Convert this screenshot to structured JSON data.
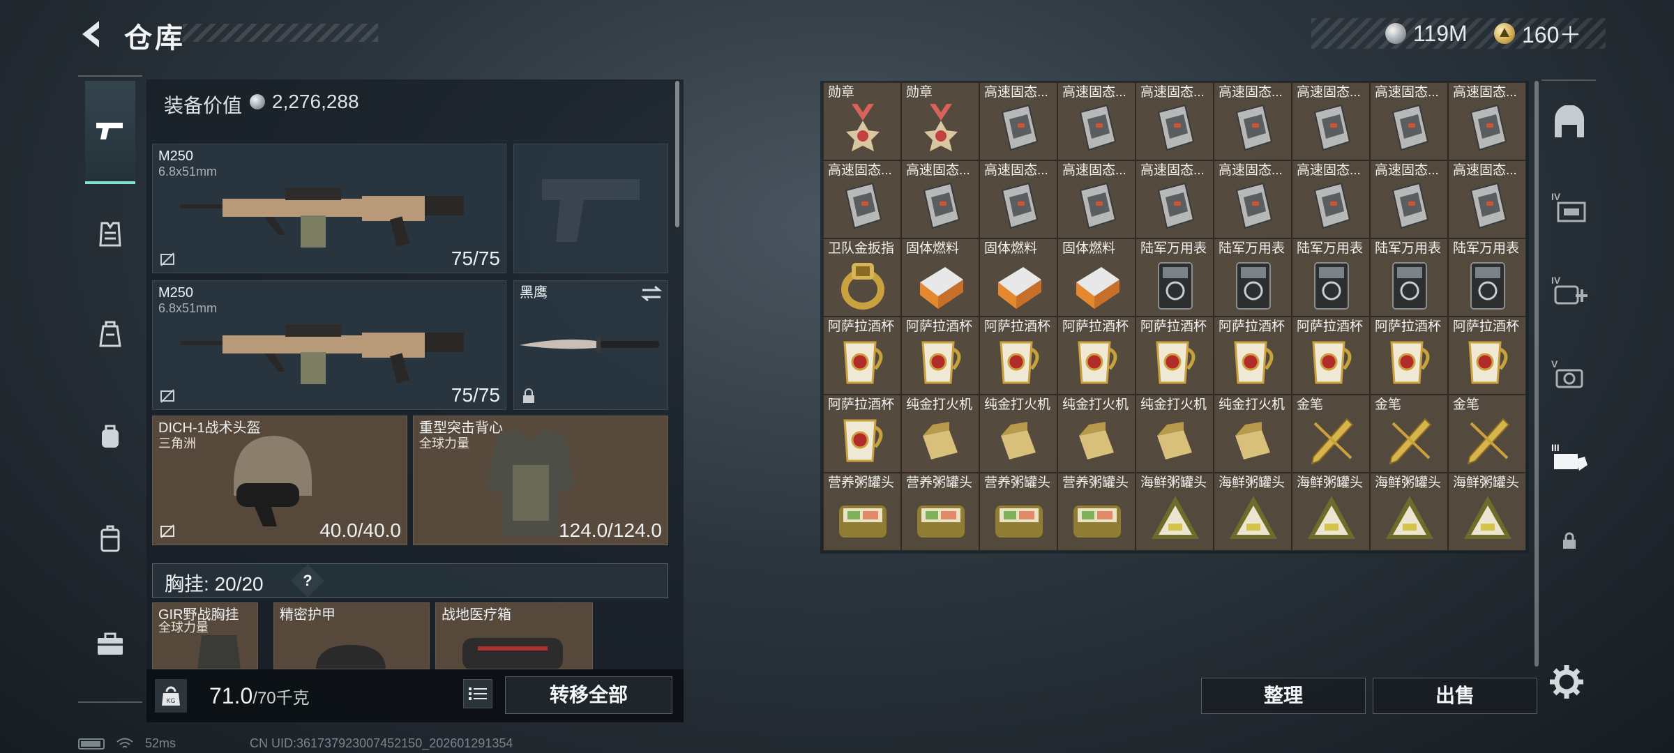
{
  "header": {
    "title": "仓库",
    "currencies": [
      {
        "icon": "silver-coin-icon",
        "amount": "119M"
      },
      {
        "icon": "gold-coin-icon",
        "amount": "160＋"
      }
    ]
  },
  "left_nav": [
    {
      "name": "weapons-tab-icon",
      "active": true
    },
    {
      "name": "armor-tab-icon",
      "active": false
    },
    {
      "name": "chest-rig-tab-icon",
      "active": false
    },
    {
      "name": "backpack-tab-icon",
      "active": false
    },
    {
      "name": "container-tab-icon",
      "active": false
    },
    {
      "name": "toolbox-tab-icon",
      "active": false
    }
  ],
  "loadout": {
    "value_label": "装备价值",
    "value": "2,276,288",
    "primary1": {
      "name": "M250",
      "caliber": "6.8x51mm",
      "ammo": "75/75"
    },
    "primary2": {
      "name": "M250",
      "caliber": "6.8x51mm",
      "ammo": "75/75"
    },
    "melee": {
      "name": "黑鹰"
    },
    "helmet": {
      "name": "DICH-1战术头盔",
      "brand": "三角洲",
      "durability": "40.0/40.0"
    },
    "armor": {
      "name": "重型突击背心",
      "brand": "全球力量",
      "durability": "124.0/124.0"
    },
    "chest_rig": {
      "label": "胸挂:",
      "value": "20/20",
      "help": "?"
    },
    "sub_slots": [
      {
        "name": "GIR野战胸挂",
        "brand": "全球力量"
      },
      {
        "name": "精密护甲",
        "brand": ""
      },
      {
        "name": "战地医疗箱",
        "brand": ""
      }
    ],
    "weight": "71.0",
    "weight_max": "/70千克",
    "kg_label": "KG",
    "transfer_all": "转移全部"
  },
  "status": {
    "ping": "52ms",
    "uid": "CN UID:3617379230074521​50_202601291354"
  },
  "warehouse": {
    "items": [
      {
        "label": "勋章",
        "icon": "medal"
      },
      {
        "label": "勋章",
        "icon": "medal"
      },
      {
        "label": "高速固态...",
        "icon": "ssd"
      },
      {
        "label": "高速固态...",
        "icon": "ssd"
      },
      {
        "label": "高速固态...",
        "icon": "ssd"
      },
      {
        "label": "高速固态...",
        "icon": "ssd"
      },
      {
        "label": "高速固态...",
        "icon": "ssd"
      },
      {
        "label": "高速固态...",
        "icon": "ssd"
      },
      {
        "label": "高速固态...",
        "icon": "ssd"
      },
      {
        "label": "高速固态...",
        "icon": "ssd"
      },
      {
        "label": "高速固态...",
        "icon": "ssd"
      },
      {
        "label": "高速固态...",
        "icon": "ssd"
      },
      {
        "label": "高速固态...",
        "icon": "ssd"
      },
      {
        "label": "高速固态...",
        "icon": "ssd"
      },
      {
        "label": "高速固态...",
        "icon": "ssd"
      },
      {
        "label": "高速固态...",
        "icon": "ssd"
      },
      {
        "label": "高速固态...",
        "icon": "ssd"
      },
      {
        "label": "高速固态...",
        "icon": "ssd"
      },
      {
        "label": "卫队金扳指",
        "icon": "ring"
      },
      {
        "label": "固体燃料",
        "icon": "fuel"
      },
      {
        "label": "固体燃料",
        "icon": "fuel"
      },
      {
        "label": "固体燃料",
        "icon": "fuel"
      },
      {
        "label": "陆军万用表",
        "icon": "meter"
      },
      {
        "label": "陆军万用表",
        "icon": "meter"
      },
      {
        "label": "陆军万用表",
        "icon": "meter"
      },
      {
        "label": "陆军万用表",
        "icon": "meter"
      },
      {
        "label": "陆军万用表",
        "icon": "meter"
      },
      {
        "label": "阿萨拉酒杯",
        "icon": "cup"
      },
      {
        "label": "阿萨拉酒杯",
        "icon": "cup"
      },
      {
        "label": "阿萨拉酒杯",
        "icon": "cup"
      },
      {
        "label": "阿萨拉酒杯",
        "icon": "cup"
      },
      {
        "label": "阿萨拉酒杯",
        "icon": "cup"
      },
      {
        "label": "阿萨拉酒杯",
        "icon": "cup"
      },
      {
        "label": "阿萨拉酒杯",
        "icon": "cup"
      },
      {
        "label": "阿萨拉酒杯",
        "icon": "cup"
      },
      {
        "label": "阿萨拉酒杯",
        "icon": "cup"
      },
      {
        "label": "阿萨拉酒杯",
        "icon": "cup"
      },
      {
        "label": "纯金打火机",
        "icon": "lighter"
      },
      {
        "label": "纯金打火机",
        "icon": "lighter"
      },
      {
        "label": "纯金打火机",
        "icon": "lighter"
      },
      {
        "label": "纯金打火机",
        "icon": "lighter"
      },
      {
        "label": "纯金打火机",
        "icon": "lighter"
      },
      {
        "label": "金笔",
        "icon": "pen"
      },
      {
        "label": "金笔",
        "icon": "pen"
      },
      {
        "label": "金笔",
        "icon": "pen"
      },
      {
        "label": "营养粥罐头",
        "icon": "can"
      },
      {
        "label": "营养粥罐头",
        "icon": "can"
      },
      {
        "label": "营养粥罐头",
        "icon": "can"
      },
      {
        "label": "营养粥罐头",
        "icon": "can"
      },
      {
        "label": "海鲜粥罐头",
        "icon": "tri"
      },
      {
        "label": "海鲜粥罐头",
        "icon": "tri"
      },
      {
        "label": "海鲜粥罐头",
        "icon": "tri"
      },
      {
        "label": "海鲜粥罐头",
        "icon": "tri"
      },
      {
        "label": "海鲜粥罐头",
        "icon": "tri"
      }
    ],
    "sort": "整理",
    "sell": "出售"
  },
  "right_nav": [
    {
      "name": "safe-box-icon",
      "tag": ""
    },
    {
      "name": "storage-tier-4-icon",
      "tag": "IV"
    },
    {
      "name": "medical-tier-4-icon",
      "tag": "IV"
    },
    {
      "name": "tier-5-icon",
      "tag": "V"
    },
    {
      "name": "tier-3-icon",
      "tag": "III"
    },
    {
      "name": "lock-icon",
      "tag": ""
    }
  ],
  "colors": {
    "accent": "#7fe3d0",
    "cell": "#5c4e40",
    "panel": "#1a2128"
  }
}
